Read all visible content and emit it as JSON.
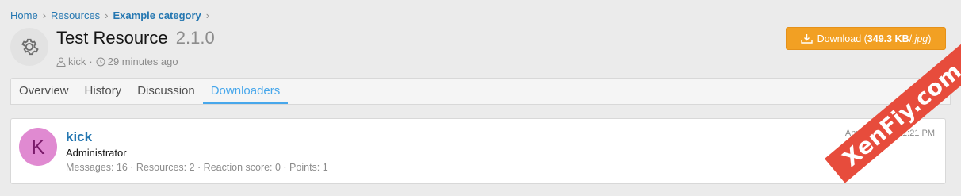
{
  "breadcrumb": {
    "items": [
      "Home",
      "Resources",
      "Example category"
    ]
  },
  "resource": {
    "icon": "gear-icon",
    "title": "Test Resource",
    "version": "2.1.0",
    "author": "kick",
    "separator": "·",
    "time": "29 minutes ago"
  },
  "download": {
    "prefix": "Download (",
    "size": "349.3 KB",
    "slash": " / ",
    "ext": ".jpg",
    "suffix": ")",
    "color": "#f2a023"
  },
  "tabs": [
    {
      "label": "Overview"
    },
    {
      "label": "History"
    },
    {
      "label": "Discussion"
    },
    {
      "label": "Downloaders",
      "active": true
    }
  ],
  "downloader": {
    "avatar_letter": "K",
    "name": "kick",
    "role": "Administrator",
    "stats": "Messages: 16 · Resources: 2 · Reaction score: 0 · Points: 1",
    "date": "Apr 9, 2020 at 1:21 PM"
  },
  "watermark": {
    "text": "XenFiy.com"
  }
}
